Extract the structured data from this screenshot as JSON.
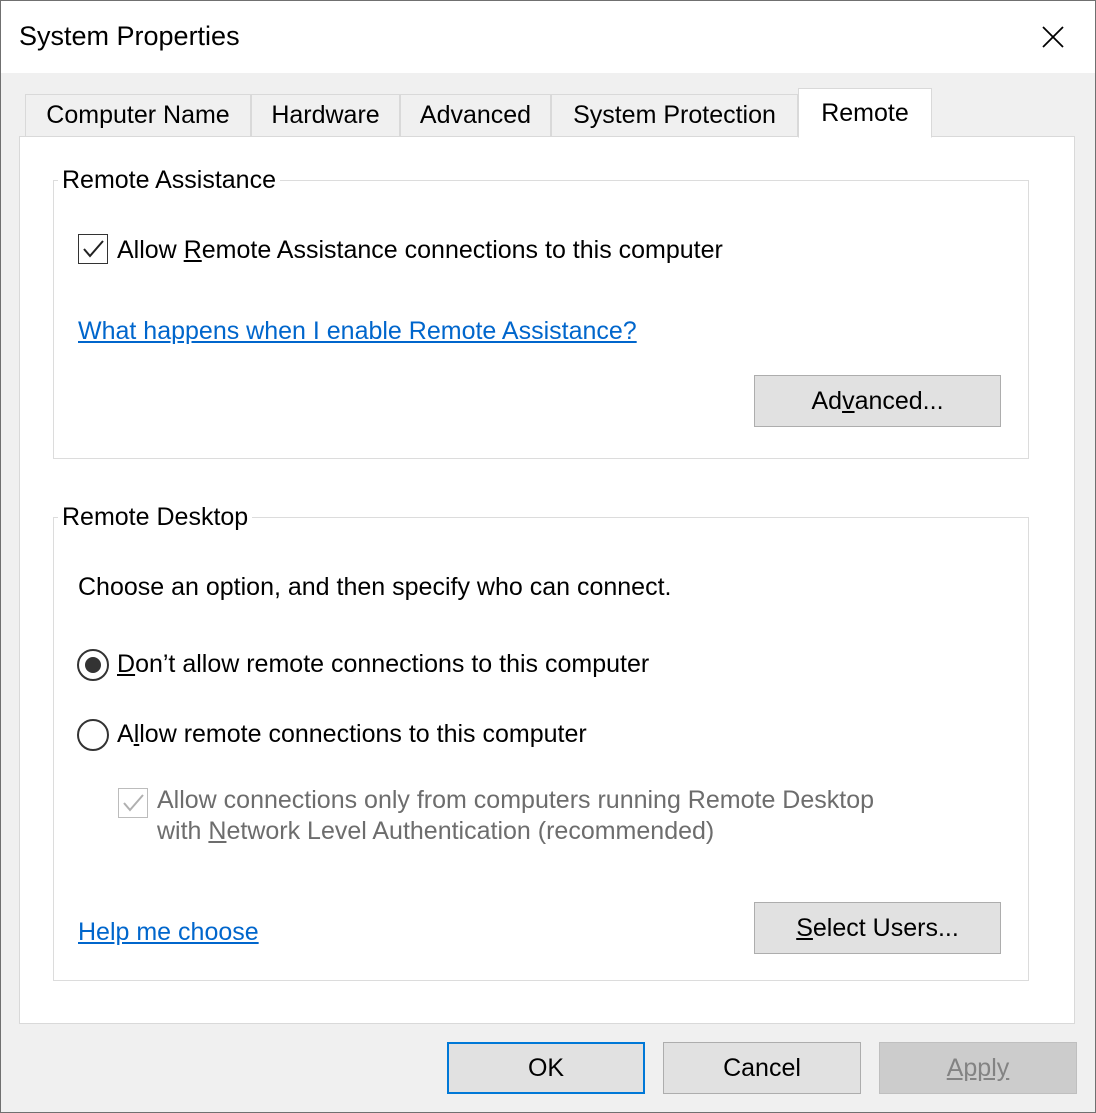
{
  "window": {
    "title": "System Properties"
  },
  "tabs": [
    {
      "label": "Computer Name",
      "active": false
    },
    {
      "label": "Hardware",
      "active": false
    },
    {
      "label": "Advanced",
      "active": false
    },
    {
      "label": "System Protection",
      "active": false
    },
    {
      "label": "Remote",
      "active": true
    }
  ],
  "remote_assistance": {
    "group_label": "Remote Assistance",
    "allow_checkbox": {
      "checked": true,
      "label_pre": "Allow ",
      "label_accel": "R",
      "label_post": "emote Assistance connections to this computer"
    },
    "help_link": "What happens when I enable Remote Assistance?",
    "advanced_button": {
      "pre": "Ad",
      "accel": "v",
      "post": "anced..."
    }
  },
  "remote_desktop": {
    "group_label": "Remote Desktop",
    "instructions": "Choose an option, and then specify who can connect.",
    "option_dont_allow": {
      "selected": true,
      "label_accel": "D",
      "label_post": "on’t allow remote connections to this computer"
    },
    "option_allow": {
      "selected": false,
      "label_pre": "A",
      "label_accel": "l",
      "label_post": "low remote connections to this computer"
    },
    "nla_checkbox": {
      "checked": true,
      "enabled": false,
      "line1": "Allow connections only from computers running Remote Desktop",
      "line2_pre": "with ",
      "line2_accel": "N",
      "line2_post": "etwork Level Authentication (recommended)"
    },
    "help_link": "Help me choose",
    "select_users_button": {
      "accel": "S",
      "post": "elect Users..."
    }
  },
  "footer": {
    "ok_label": "OK",
    "cancel_label": "Cancel",
    "apply_label": "Apply",
    "apply_enabled": false
  },
  "colors": {
    "link": "#0066cc",
    "default_button_border": "#0078d7",
    "disabled_text": "#838383"
  }
}
